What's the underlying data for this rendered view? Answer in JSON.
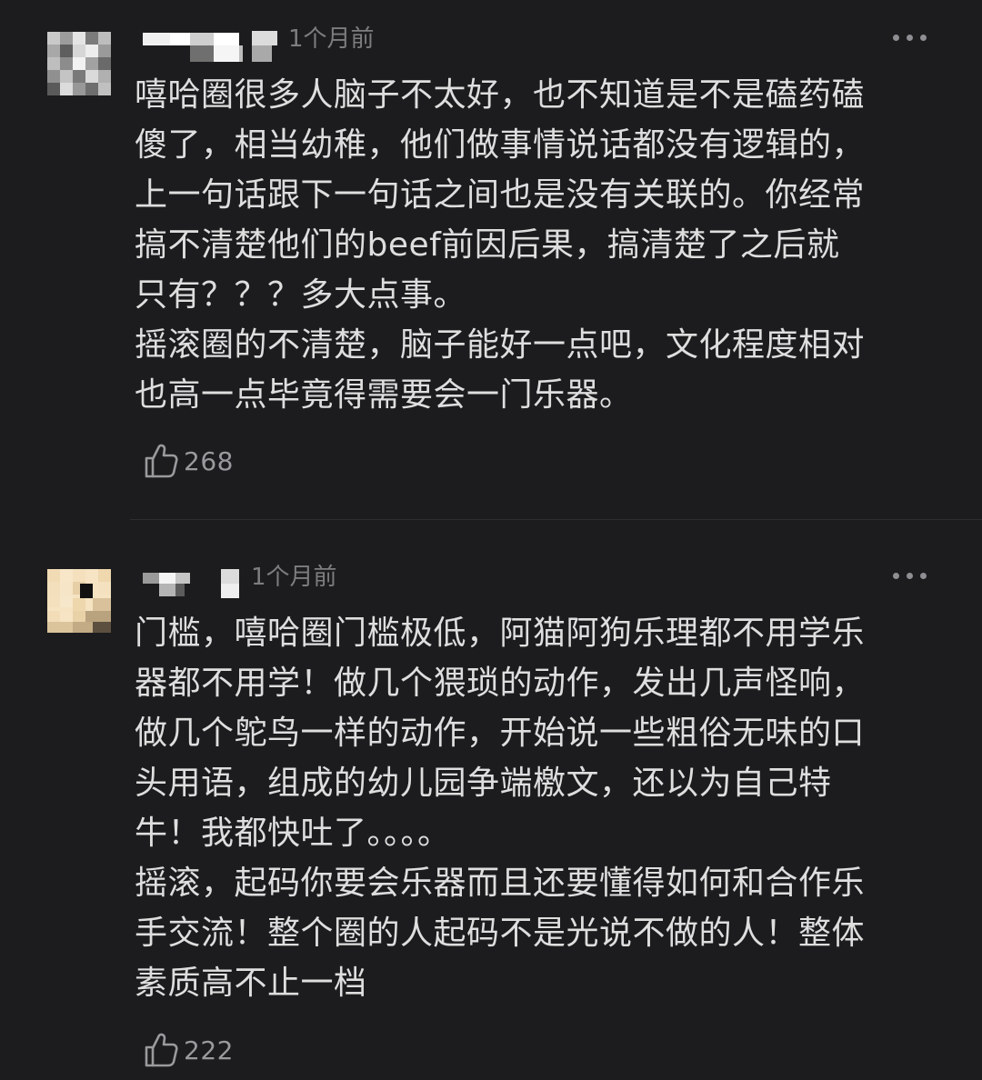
{
  "comments": [
    {
      "time": "1个月前",
      "paragraphs": [
        {
          "lines": [
            "嘻哈圈很多人脑子不太好，也不知道是不是磕药磕",
            "傻了，相当幼稚，他们做事情说话都没有逻辑的，",
            "上一句话跟下一句话之间也是没有关联的。你经常",
            "搞不清楚他们的beef前因后果，搞清楚了之后就",
            "只有？？？多大点事。"
          ]
        },
        {
          "lines": [
            "摇滚圈的不清楚，脑子能好一点吧，文化程度相对",
            "也高一点毕竟得需要会一门乐器。"
          ]
        }
      ],
      "likes": "268",
      "icons": {
        "more": "more-dots-icon",
        "like": "thumbs-up-icon"
      }
    },
    {
      "time": "1个月前",
      "paragraphs": [
        {
          "lines": [
            "门槛，嘻哈圈门槛极低，阿猫阿狗乐理都不用学乐",
            "器都不用学！做几个猥琐的动作，发出几声怪响，",
            "做几个鸵鸟一样的动作，开始说一些粗俗无味的口",
            "头用语，组成的幼儿园争端檄文，还以为自己特",
            "牛！我都快吐了。。。。"
          ]
        },
        {
          "lines": [
            "摇滚，起码你要会乐器而且还要懂得如何和合作乐",
            "手交流！整个圈的人起码不是光说不做的人！整体",
            "素质高不止一档"
          ]
        }
      ],
      "likes": "222",
      "icons": {
        "more": "more-dots-icon",
        "like": "thumbs-up-icon"
      }
    }
  ],
  "colors": {
    "background": "#1c1c1e",
    "text": "#dedede",
    "muted": "#7d7d80",
    "divider": "#2e2e31"
  }
}
